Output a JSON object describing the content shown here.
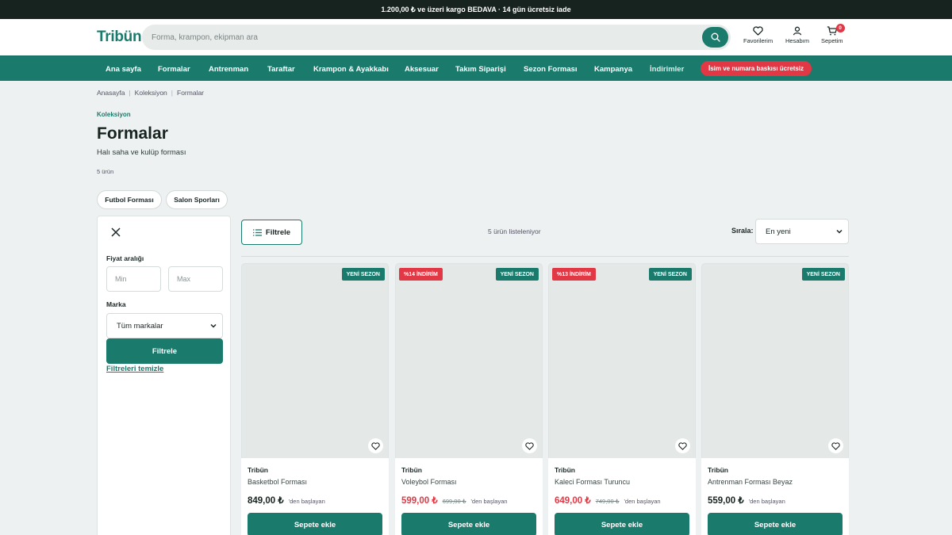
{
  "topbar": {
    "text": "1.200,00 ₺ ve üzeri kargo BEDAVA · 14 gün ücretsiz iade"
  },
  "header": {
    "logo": "Tribün",
    "search_placeholder": "Forma, krampon, ekipman ara",
    "icons": [
      {
        "label": "Favorilerim",
        "icon": "heart-icon"
      },
      {
        "label": "Hesabım",
        "icon": "user-icon"
      },
      {
        "label": "Sepetim",
        "icon": "cart-icon",
        "badge": "0"
      }
    ]
  },
  "nav": {
    "items": [
      "Ana sayfa",
      "Formalar",
      "Antrenman",
      "Taraftar",
      "Krampon & Ayakkabı",
      "Aksesuar",
      "Takım Siparişi",
      "Sezon Forması",
      "Kampanya",
      "İndirimler"
    ],
    "promo": "İsim ve numara baskısı ücretsiz"
  },
  "breadcrumb": [
    "Anasayfa",
    "Koleksiyon",
    "Formalar"
  ],
  "collection": {
    "eyebrow": "Koleksiyon",
    "title": "Formalar",
    "subtitle": "Halı saha ve kulüp forması",
    "count": "5 ürün"
  },
  "chips": [
    "Futbol Forması",
    "Salon Sporları"
  ],
  "sidebar": {
    "price_label": "Fiyat aralığı",
    "min_placeholder": "Min",
    "max_placeholder": "Max",
    "brand_label": "Marka",
    "brand_value": "Tüm markalar",
    "apply": "Filtrele",
    "clear": "Filtreleri temizle"
  },
  "toolbar": {
    "filter_button": "Filtrele",
    "listing": "5 ürün listeleniyor",
    "sort_label": "Sırala:",
    "sort_value": "En yeni"
  },
  "products": [
    {
      "brand": "Tribün",
      "name": "Basketbol Forması",
      "price": "849,00 ₺",
      "old_price": "",
      "from": "'den başlayan",
      "badge_new": "YENİ SEZON",
      "badge_discount": "",
      "button": "Sepete ekle"
    },
    {
      "brand": "Tribün",
      "name": "Voleybol Forması",
      "price": "599,00 ₺",
      "old_price": "699,00 ₺",
      "from": "'den başlayan",
      "badge_new": "YENİ SEZON",
      "badge_discount": "%14 İNDİRİM",
      "button": "Sepete ekle"
    },
    {
      "brand": "Tribün",
      "name": "Kaleci Forması Turuncu",
      "price": "649,00 ₺",
      "old_price": "749,00 ₺",
      "from": "'den başlayan",
      "badge_new": "YENİ SEZON",
      "badge_discount": "%13 İNDİRİM",
      "button": "Sepete ekle"
    },
    {
      "brand": "Tribün",
      "name": "Antrenman Forması Beyaz",
      "price": "559,00 ₺",
      "old_price": "",
      "from": "'den başlayan",
      "badge_new": "YENİ SEZON",
      "badge_discount": "",
      "button": "Sepete ekle"
    }
  ],
  "colors": {
    "brand": "#1a7a6c",
    "sale": "#e23744",
    "topbar": "#17231f"
  }
}
